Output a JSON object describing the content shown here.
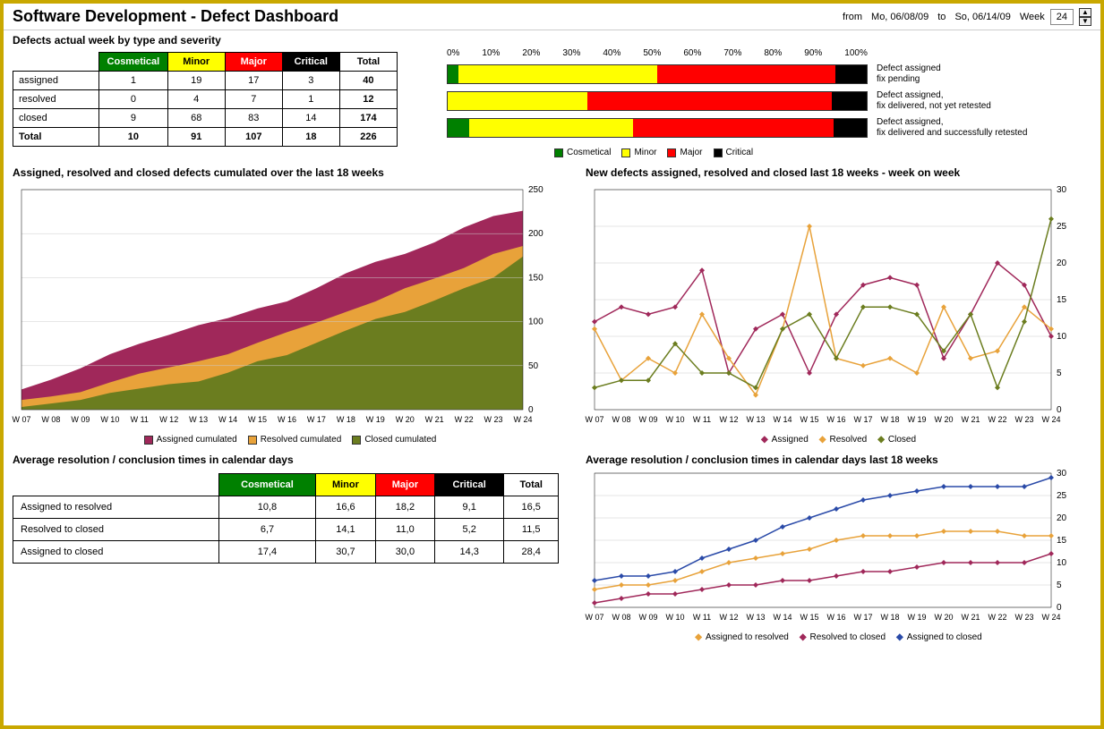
{
  "header": {
    "title": "Software Development - Defect Dashboard",
    "from_label": "from",
    "from_date": "Mo, 06/08/09",
    "to_label": "to",
    "to_date": "So, 06/14/09",
    "week_label": "Week",
    "week_num": "24"
  },
  "section1": {
    "title": "Defects actual week by type and severity",
    "cols": [
      "",
      "Cosmetical",
      "Minor",
      "Major",
      "Critical",
      "Total"
    ],
    "rows": [
      {
        "label": "assigned",
        "vals": [
          1,
          19,
          17,
          3,
          40
        ]
      },
      {
        "label": "resolved",
        "vals": [
          0,
          4,
          7,
          1,
          12
        ]
      },
      {
        "label": "closed",
        "vals": [
          9,
          68,
          83,
          14,
          174
        ]
      }
    ],
    "total_row": {
      "label": "Total",
      "vals": [
        10,
        91,
        107,
        18,
        226
      ]
    },
    "pct_ticks": [
      "0%",
      "10%",
      "20%",
      "30%",
      "40%",
      "50%",
      "60%",
      "70%",
      "80%",
      "90%",
      "100%"
    ],
    "stacked": [
      {
        "key": "assigned",
        "desc1": "Defect assigned",
        "desc2": "fix pending"
      },
      {
        "key": "resolved",
        "desc1": "Defect assigned,",
        "desc2": "fix delivered, not yet retested"
      },
      {
        "key": "closed",
        "desc1": "Defect assigned,",
        "desc2": "fix delivered and successfully retested"
      }
    ],
    "legend": [
      {
        "name": "Cosmetical",
        "color": "#008000"
      },
      {
        "name": "Minor",
        "color": "#ffff00"
      },
      {
        "name": "Major",
        "color": "#ff0000"
      },
      {
        "name": "Critical",
        "color": "#000000"
      }
    ]
  },
  "section2": {
    "title": "Assigned, resolved and closed defects cumulated over the last 18 weeks",
    "legend": [
      "Assigned cumulated",
      "Resolved cumulated",
      "Closed cumulated"
    ]
  },
  "section3": {
    "title": "New defects assigned, resolved and closed last 18 weeks - week on week",
    "legend": [
      "Assigned",
      "Resolved",
      "Closed"
    ]
  },
  "section4": {
    "title": "Average resolution / conclusion times in calendar days",
    "cols": [
      "",
      "Cosmetical",
      "Minor",
      "Major",
      "Critical",
      "Total"
    ],
    "rows": [
      {
        "label": "Assigned to resolved",
        "vals": [
          "10,8",
          "16,6",
          "18,2",
          "9,1",
          "16,5"
        ]
      },
      {
        "label": "Resolved to closed",
        "vals": [
          "6,7",
          "14,1",
          "11,0",
          "5,2",
          "11,5"
        ]
      },
      {
        "label": "Assigned to closed",
        "vals": [
          "17,4",
          "30,7",
          "30,0",
          "14,3",
          "28,4"
        ]
      }
    ]
  },
  "section5": {
    "title": "Average resolution / conclusion times in calendar days last 18 weeks",
    "legend": [
      "Assigned to resolved",
      "Resolved to closed",
      "Assigned to closed"
    ]
  },
  "weeks": [
    "W 07",
    "W 08",
    "W 09",
    "W 10",
    "W 11",
    "W 12",
    "W 13",
    "W 14",
    "W 15",
    "W 16",
    "W 17",
    "W 18",
    "W 19",
    "W 20",
    "W 21",
    "W 22",
    "W 23",
    "W 24"
  ],
  "colors": {
    "cosmetical": "#008000",
    "minor": "#ffff00",
    "major": "#ff0000",
    "critical": "#000000",
    "assigned_line": "#a0285a",
    "resolved_line": "#e8a23a",
    "closed_line": "#6b7d1f",
    "assigned_area": "#a0285a",
    "resolved_area": "#e8a23a",
    "closed_area": "#6b7d1f",
    "a2r": "#e8a23a",
    "r2c": "#a0285a",
    "a2c": "#2a4aa8"
  },
  "chart_data": [
    {
      "id": "stacked-pct",
      "type": "bar",
      "orientation": "horizontal-stacked-100",
      "categories": [
        "assigned",
        "resolved",
        "closed"
      ],
      "series": [
        {
          "name": "Cosmetical",
          "values": [
            2.5,
            0.0,
            5.2
          ]
        },
        {
          "name": "Minor",
          "values": [
            47.5,
            33.3,
            39.1
          ]
        },
        {
          "name": "Major",
          "values": [
            42.5,
            58.3,
            47.7
          ]
        },
        {
          "name": "Critical",
          "values": [
            7.5,
            8.3,
            8.0
          ]
        }
      ],
      "xlabel": "%",
      "xlim": [
        0,
        100
      ]
    },
    {
      "id": "cumulative-area",
      "type": "area",
      "stacked": true,
      "x": [
        "W 07",
        "W 08",
        "W 09",
        "W 10",
        "W 11",
        "W 12",
        "W 13",
        "W 14",
        "W 15",
        "W 16",
        "W 17",
        "W 18",
        "W 19",
        "W 20",
        "W 21",
        "W 22",
        "W 23",
        "W 24"
      ],
      "series": [
        {
          "name": "Closed cumulated",
          "values": [
            3,
            7,
            11,
            19,
            24,
            29,
            32,
            42,
            55,
            62,
            76,
            90,
            103,
            111,
            124,
            138,
            150,
            174
          ]
        },
        {
          "name": "Resolved cumulated",
          "values": [
            8,
            8,
            9,
            12,
            17,
            19,
            23,
            21,
            21,
            26,
            23,
            21,
            20,
            27,
            25,
            23,
            27,
            12
          ]
        },
        {
          "name": "Assigned cumulated",
          "values": [
            12,
            19,
            27,
            32,
            34,
            37,
            41,
            41,
            39,
            35,
            39,
            44,
            45,
            39,
            41,
            46,
            43,
            40
          ]
        }
      ],
      "ylim": [
        0,
        250
      ],
      "title": "Assigned, resolved and closed defects cumulated over the last 18 weeks"
    },
    {
      "id": "week-on-week",
      "type": "line",
      "x": [
        "W 07",
        "W 08",
        "W 09",
        "W 10",
        "W 11",
        "W 12",
        "W 13",
        "W 14",
        "W 15",
        "W 16",
        "W 17",
        "W 18",
        "W 19",
        "W 20",
        "W 21",
        "W 22",
        "W 23",
        "W 24"
      ],
      "series": [
        {
          "name": "Assigned",
          "values": [
            12,
            14,
            13,
            14,
            19,
            5,
            11,
            13,
            5,
            13,
            17,
            18,
            17,
            7,
            13,
            20,
            17,
            10
          ]
        },
        {
          "name": "Resolved",
          "values": [
            11,
            4,
            7,
            5,
            13,
            7,
            2,
            11,
            25,
            7,
            6,
            7,
            5,
            14,
            7,
            8,
            14,
            11
          ]
        },
        {
          "name": "Closed",
          "values": [
            3,
            4,
            4,
            9,
            5,
            5,
            3,
            11,
            13,
            7,
            14,
            14,
            13,
            8,
            13,
            3,
            12,
            26
          ]
        }
      ],
      "ylim": [
        0,
        30
      ],
      "title": "New defects assigned, resolved and closed last 18 weeks - week on week"
    },
    {
      "id": "avg-times-line",
      "type": "line",
      "x": [
        "W 07",
        "W 08",
        "W 09",
        "W 10",
        "W 11",
        "W 12",
        "W 13",
        "W 14",
        "W 15",
        "W 16",
        "W 17",
        "W 18",
        "W 19",
        "W 20",
        "W 21",
        "W 22",
        "W 23",
        "W 24"
      ],
      "series": [
        {
          "name": "Assigned to resolved",
          "values": [
            4,
            5,
            5,
            6,
            8,
            10,
            11,
            12,
            13,
            15,
            16,
            16,
            16,
            17,
            17,
            17,
            16,
            16
          ]
        },
        {
          "name": "Resolved to closed",
          "values": [
            1,
            2,
            3,
            3,
            4,
            5,
            5,
            6,
            6,
            7,
            8,
            8,
            9,
            10,
            10,
            10,
            10,
            12
          ]
        },
        {
          "name": "Assigned to closed",
          "values": [
            6,
            7,
            7,
            8,
            11,
            13,
            15,
            18,
            20,
            22,
            24,
            25,
            26,
            27,
            27,
            27,
            27,
            29
          ]
        }
      ],
      "ylim": [
        0,
        30
      ],
      "title": "Average resolution / conclusion times in calendar days last 18 weeks"
    }
  ]
}
